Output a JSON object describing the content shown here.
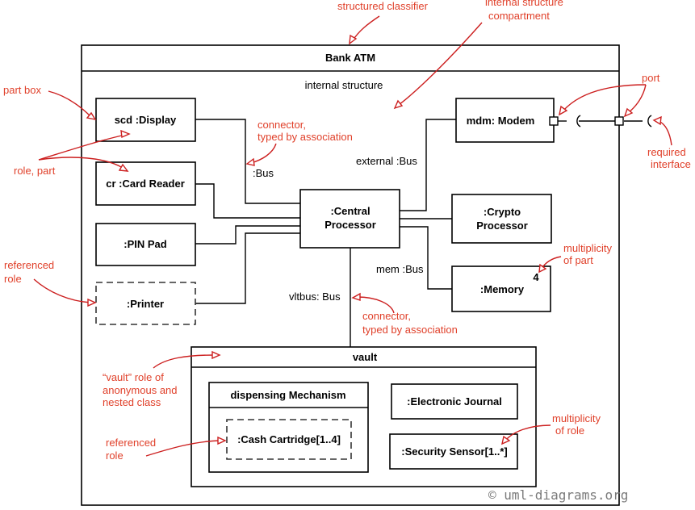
{
  "classifier": {
    "title": "Bank ATM",
    "compartment_label": "internal structure"
  },
  "parts": {
    "display": "scd :Display",
    "card_reader": "cr :Card Reader",
    "pin_pad": ":PIN Pad",
    "printer": ":Printer",
    "central_processor": [
      ":Central",
      "Processor"
    ],
    "modem": "mdm: Modem",
    "crypto_processor": [
      ":Crypto",
      "Processor"
    ],
    "memory": ":Memory",
    "memory_multiplicity": "4"
  },
  "connectors": {
    "bus": ":Bus",
    "external_bus": "external :Bus",
    "mem_bus": "mem :Bus",
    "vltbus": "vltbus: Bus"
  },
  "vault": {
    "title": "vault",
    "dispensing_mechanism": "dispensing Mechanism",
    "cash_cartridge": ":Cash Cartridge[1..4]",
    "electronic_journal": ":Electronic Journal",
    "security_sensor": ":Security Sensor[1..*]"
  },
  "annotations": {
    "structured_classifier": "structured classifier",
    "internal_structure_compartment": [
      "internal structure",
      "compartment"
    ],
    "part_box": "part box",
    "role_part": "role, part",
    "connector_typed": [
      "connector,",
      "typed by association"
    ],
    "connector_typed_2": [
      "connector,",
      "typed by association"
    ],
    "port": "port",
    "required_interface": [
      "required",
      "interface"
    ],
    "referenced_role": [
      "referenced",
      "role"
    ],
    "referenced_role_2": [
      "referenced",
      "role"
    ],
    "multiplicity_of_part": [
      "multiplicity",
      "of part"
    ],
    "vault_role": [
      "“vault” role of",
      "anonymous and",
      "nested class"
    ],
    "multiplicity_of_role": [
      "multiplicity",
      "of role"
    ]
  },
  "watermark": "© uml-diagrams.org",
  "colors": {
    "annotation": "#e0402a",
    "arrow": "#cc1f1f",
    "line": "#000000"
  }
}
